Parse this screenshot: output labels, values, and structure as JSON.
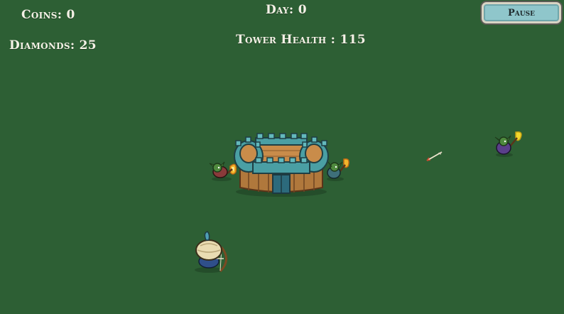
{
  "hud": {
    "coins_label": "Coins: 0",
    "diamonds_label": "Diamonds: 25",
    "day_label": "Day: 0",
    "tower_health_label": "Tower Health : 115"
  },
  "controls": {
    "pause_label": "Pause"
  },
  "colors": {
    "grass": "#2d5f34",
    "hud_text": "#f4f1e6",
    "pause_button": "#8fc6cb",
    "castle_stone": "#4a9fa4",
    "castle_wood": "#b0783c"
  },
  "sprites": {
    "castle": "castle-tower-icon",
    "goblin_left": "goblin-torch-icon",
    "goblin_right": "goblin-torch-icon",
    "goblin_far": "goblin-torch-icon",
    "arrow": "arrow-projectile-icon",
    "archer": "archer-player-icon"
  }
}
